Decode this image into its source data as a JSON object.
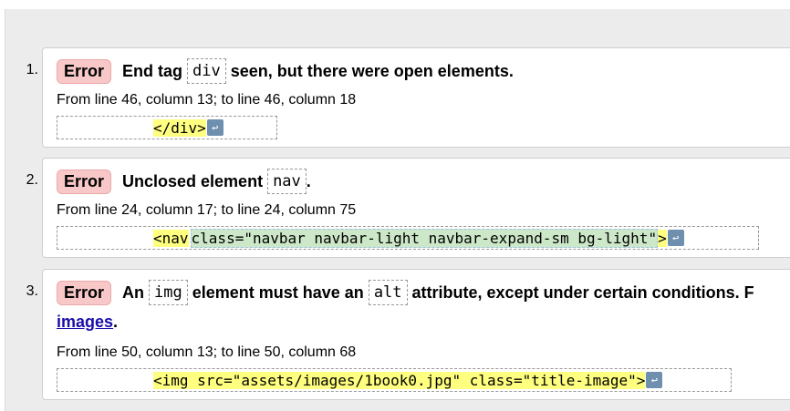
{
  "messages": [
    {
      "number": "1.",
      "type": "Error",
      "parts": {
        "pre": "End tag",
        "code": "div",
        "post": "seen, but there were open elements."
      },
      "location": "From line 46, column 13; to line 46, column 18",
      "extract": {
        "highlight": "</div>",
        "return_icon": "↩"
      }
    },
    {
      "number": "2.",
      "type": "Error",
      "parts": {
        "pre": "Unclosed element",
        "code": "nav",
        "post": "."
      },
      "location": "From line 24, column 17; to line 24, column 75",
      "extract": {
        "highlight_start": "<nav",
        "highlight_mid": "class=\"navbar navbar-light navbar-expand-sm bg-light\"",
        "highlight_end": ">",
        "return_icon": "↩"
      }
    },
    {
      "number": "3.",
      "type": "Error",
      "parts": {
        "pre": "An",
        "code1": "img",
        "mid": "element must have an",
        "code2": "alt",
        "post": "attribute, except under certain conditions. F",
        "link": "images",
        "tail": "."
      },
      "location": "From line 50, column 13; to line 50, column 68",
      "extract": {
        "highlight": "<img src=\"assets/images/1book0.jpg\" class=\"title-image\">",
        "return_icon": "↩"
      }
    }
  ]
}
